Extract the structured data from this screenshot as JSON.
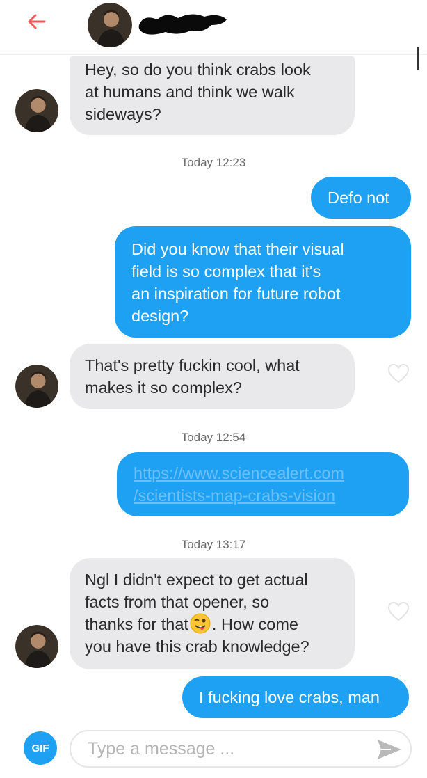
{
  "header": {
    "back_icon": "arrow-left-icon",
    "accent_color": "#f25a5a"
  },
  "messages": [
    {
      "side": "in",
      "text": "Hey, so do you think crabs look\nat humans and think we walk\nsideways?"
    },
    {
      "timestamp": "Today 12:23"
    },
    {
      "side": "out",
      "text": "Defo not"
    },
    {
      "side": "out",
      "text": "Did you know that their visual\nfield is so complex that it's\nan inspiration for future robot\ndesign?"
    },
    {
      "side": "in",
      "text": "That's pretty fuckin cool, what\nmakes it so complex?"
    },
    {
      "timestamp": "Today 12:54"
    },
    {
      "side": "out",
      "link": true,
      "text": "https://www.sciencealert.com\n/scientists-map-crabs-vision"
    },
    {
      "timestamp": "Today 13:17"
    },
    {
      "side": "in",
      "text_before_emoji": "Ngl I didn't expect to get actual\nfacts from that opener, so\nthanks for that",
      "emoji": "winking-face-with-tongue",
      "text_after_emoji": ". How come\nyou have this crab knowledge?"
    },
    {
      "side": "out",
      "text": "I fucking love crabs, man"
    }
  ],
  "composer": {
    "gif_label": "GIF",
    "placeholder": "Type a message ...",
    "send_icon": "send-icon"
  },
  "colors": {
    "outgoing_bubble": "#1ea1f2",
    "incoming_bubble": "#e9e9eb",
    "link_text": "#6bbff5"
  }
}
